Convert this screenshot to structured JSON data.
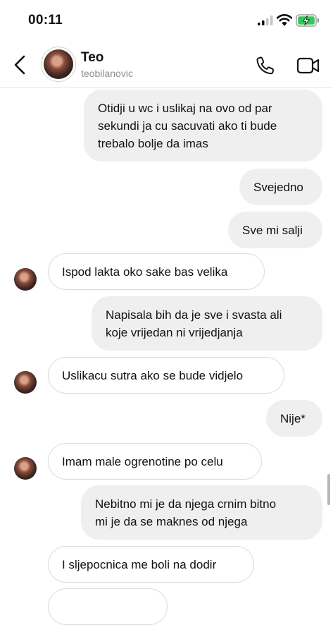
{
  "status_bar": {
    "time": "00:11"
  },
  "header": {
    "name": "Teo",
    "handle": "teobilanovic"
  },
  "messages": [
    {
      "dir": "out",
      "lines": [
        "Otidji u wc i uslikaj na ovo od par",
        "sekundi ja cu sacuvati ako ti bude",
        "trebalo bolje da imas"
      ]
    },
    {
      "dir": "out",
      "lines": [
        "Svejedno"
      ]
    },
    {
      "dir": "out",
      "lines": [
        "Sve mi salji"
      ]
    },
    {
      "dir": "in",
      "lines": [
        "Ispod lakta oko sake bas velika"
      ]
    },
    {
      "dir": "out",
      "lines": [
        "Napisala bih da je sve i svasta ali",
        "koje vrijedan ni vrijedjanja"
      ]
    },
    {
      "dir": "in",
      "lines": [
        "Uslikacu sutra ako se bude vidjelo"
      ]
    },
    {
      "dir": "out",
      "lines": [
        "Nije*"
      ]
    },
    {
      "dir": "in",
      "lines": [
        "Imam male ogrenotine po celu"
      ]
    },
    {
      "dir": "out",
      "lines": [
        "Nebitno mi je da njega crnim bitno",
        "mi je da se maknes od njega"
      ]
    },
    {
      "dir": "in",
      "lines": [
        "I sljepocnica me boli na dodir"
      ]
    }
  ]
}
